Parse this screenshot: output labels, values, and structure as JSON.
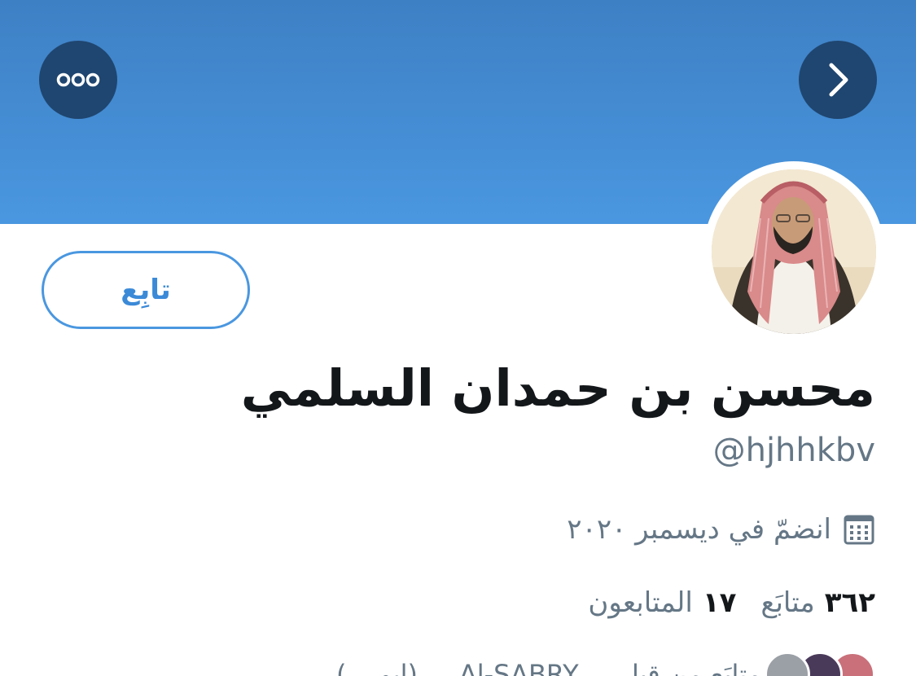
{
  "header": {
    "more_icon": "more-dots-icon",
    "next_icon": "chevron-right-icon",
    "banner_color": "#4a97e0"
  },
  "profile": {
    "name": "محسن بن حمدان السلمي",
    "handle": "@hjhhkbv",
    "joined": "انضمّ في ديسمبر ٢٠٢٠",
    "follow_label": "تابِع",
    "following_count": "٣٦٢",
    "following_label": "متابَع",
    "followers_count": "١٧",
    "followers_label": "المتابعون"
  },
  "followed_by": {
    "text": "متابَع من قبل ... Al-SABRY ... (ابو ...)"
  }
}
